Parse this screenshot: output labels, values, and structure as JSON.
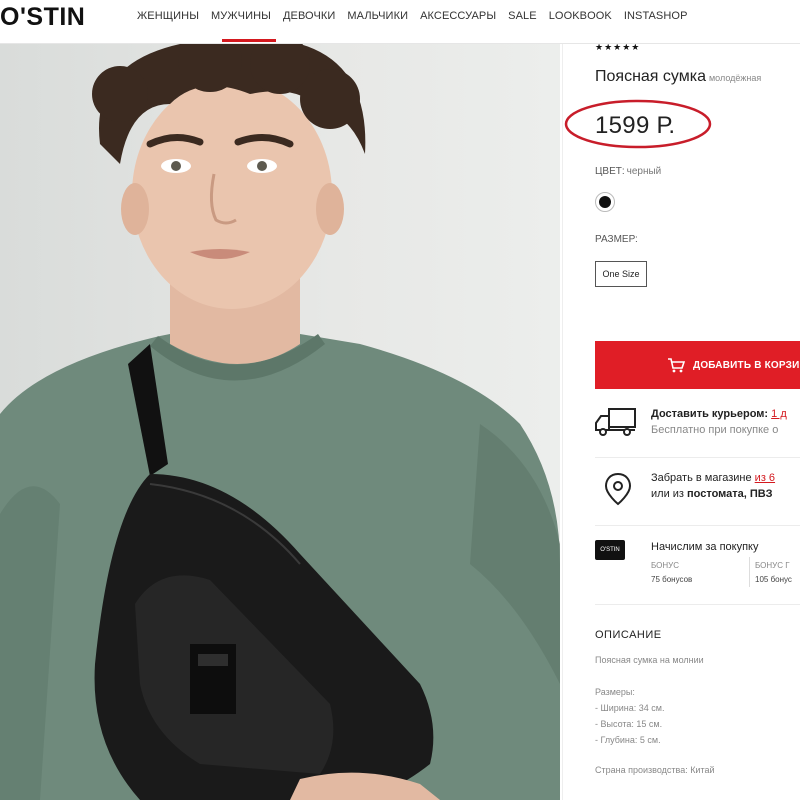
{
  "header": {
    "logo": "O'STIN",
    "nav": [
      "ЖЕНЩИНЫ",
      "МУЖЧИНЫ",
      "ДЕВОЧКИ",
      "МАЛЬЧИКИ",
      "АКСЕССУАРЫ",
      "SALE",
      "LOOKBOOK",
      "INSTASHOP"
    ],
    "active_nav": "МУЖЧИНЫ"
  },
  "product": {
    "rating_stars": "★★★★★",
    "title": "Поясная сумка",
    "title_suffix": "молодёжная",
    "price": "1599 Р.",
    "color_label": "ЦВЕТ:",
    "color_value": "черный",
    "size_label": "РАЗМЕР:",
    "size_option": "One Size",
    "add_to_cart": "ДОБАВИТЬ В КОРЗИНУ"
  },
  "delivery": {
    "courier_title": "Доставить курьером:",
    "courier_link": "1 д",
    "courier_sub": "Бесплатно при покупке о",
    "pickup_title": "Забрать в магазине",
    "pickup_link": "из 6",
    "pickup_sub_prefix": "или из",
    "pickup_sub_bold": "постомата, ПВЗ"
  },
  "bonus": {
    "card_label": "O'STIN",
    "title": "Начислим за покупку",
    "col1_label": "БОНУС",
    "col1_value": "75 бонусов",
    "col2_label": "БОНУС Г",
    "col2_value": "105 бонус"
  },
  "description": {
    "heading": "ОПИСАНИЕ",
    "lines": [
      "Поясная сумка на молнии",
      "",
      "Размеры:",
      "- Ширина: 34 см.",
      "- Высота: 15 см.",
      "- Глубина: 5 см.",
      "",
      "Страна производства: Китай"
    ]
  },
  "colors": {
    "accent": "#e01e26",
    "ring": "#c81d2a",
    "shirt": "#6f8a7c",
    "bag": "#1a1a1a"
  }
}
